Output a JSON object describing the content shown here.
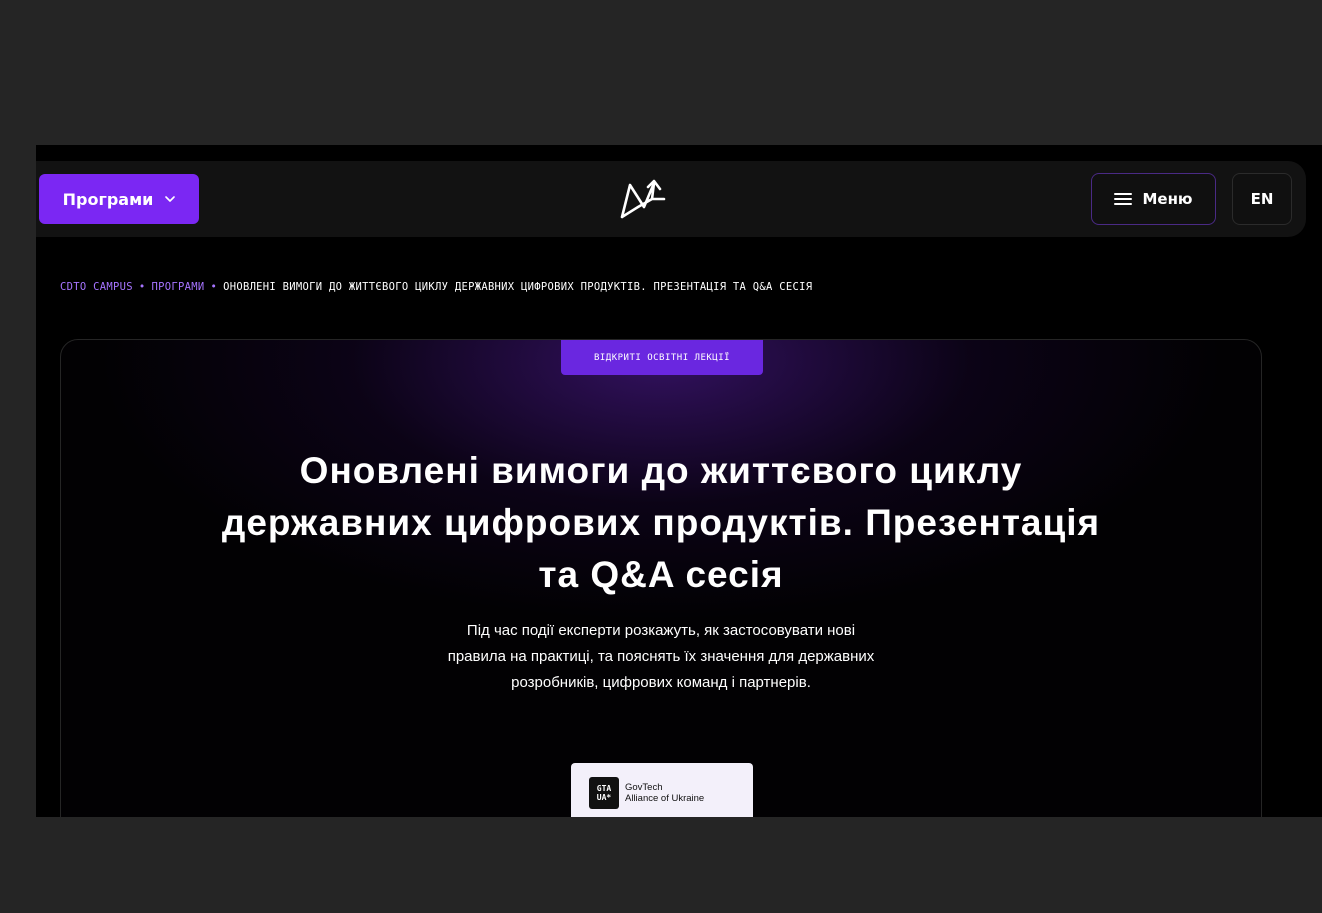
{
  "nav": {
    "programs_label": "Програми",
    "menu_label": "Меню",
    "lang_label": "EN"
  },
  "breadcrumb": {
    "items": [
      "CDTO CAMPUS",
      "ПРОГРАМИ",
      "ОНОВЛЕНІ ВИМОГИ ДО ЖИТТЄВОГО ЦИКЛУ ДЕРЖАВНИХ ЦИФРОВИХ ПРОДУКТІВ. ПРЕЗЕНТАЦІЯ ТА Q&A СЕСІЯ"
    ],
    "separator": "•"
  },
  "hero": {
    "tag": "ВІДКРИТІ ОСВІТНІ ЛЕКЦІЇ",
    "title_lines": [
      "Оновлені вимоги до життєвого циклу",
      "державних цифрових продуктів. Презентація",
      "та Q&A сесія"
    ],
    "description_lines": [
      "Під час події експерти розкажуть, як застосовувати нові",
      "правила на практиці, та пояснять їх значення для державних",
      "розробників, цифрових команд і партнерів."
    ]
  },
  "partner": {
    "badge_top": "GTA",
    "badge_bottom": "UA*",
    "name_line1": "GovTech",
    "name_line2": "Alliance of Ukraine"
  },
  "colors": {
    "accent": "#7b27f3",
    "tag_bg": "#6a27e0",
    "breadcrumb_link": "#a674ff",
    "page_bg": "#000000",
    "outer_bg": "#252525"
  }
}
